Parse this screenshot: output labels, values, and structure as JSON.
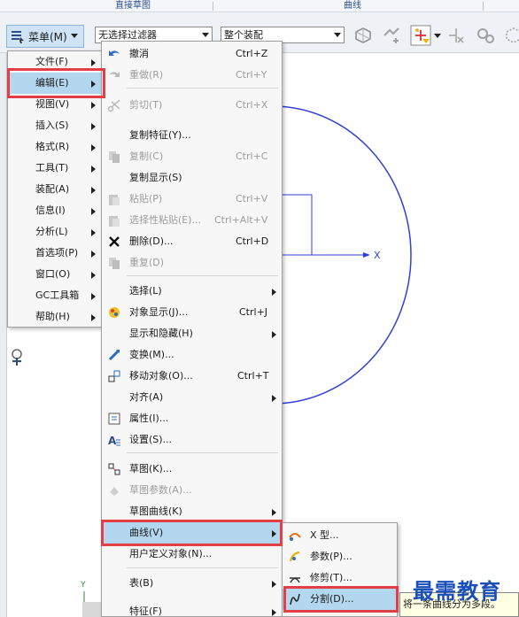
{
  "ribbon_groups": [
    "直接草图",
    "曲线"
  ],
  "toolbar": {
    "menu_button_label": "菜单(M)",
    "filter_combo_value": "无选择过滤器",
    "assembly_combo_value": "整个装配"
  },
  "main_menu": [
    {
      "label": "文件(F)"
    },
    {
      "label": "编辑(E)"
    },
    {
      "label": "视图(V)"
    },
    {
      "label": "插入(S)"
    },
    {
      "label": "格式(R)"
    },
    {
      "label": "工具(T)"
    },
    {
      "label": "装配(A)"
    },
    {
      "label": "信息(I)"
    },
    {
      "label": "分析(L)"
    },
    {
      "label": "首选项(P)"
    },
    {
      "label": "窗口(O)"
    },
    {
      "label": "GC工具箱"
    },
    {
      "label": "帮助(H)"
    }
  ],
  "edit_menu": [
    {
      "label": "撤消",
      "shortcut": "Ctrl+Z"
    },
    {
      "label": "重做(R)",
      "shortcut": "Ctrl+Y"
    },
    {
      "label": "剪切(T)",
      "shortcut": "Ctrl+X"
    },
    {
      "label": "复制特征(Y)...",
      "shortcut": ""
    },
    {
      "label": "复制(C)",
      "shortcut": "Ctrl+C"
    },
    {
      "label": "复制显示(S)",
      "shortcut": ""
    },
    {
      "label": "粘贴(P)",
      "shortcut": "Ctrl+V"
    },
    {
      "label": "选择性粘贴(E)...",
      "shortcut": "Ctrl+Alt+V"
    },
    {
      "label": "删除(D)...",
      "shortcut": "Ctrl+D"
    },
    {
      "label": "重复(D)",
      "shortcut": ""
    },
    {
      "label": "选择(L)",
      "shortcut": ""
    },
    {
      "label": "对象显示(J)...",
      "shortcut": "Ctrl+J"
    },
    {
      "label": "显示和隐藏(H)",
      "shortcut": ""
    },
    {
      "label": "变换(M)...",
      "shortcut": ""
    },
    {
      "label": "移动对象(O)...",
      "shortcut": "Ctrl+T"
    },
    {
      "label": "对齐(A)",
      "shortcut": ""
    },
    {
      "label": "属性(I)...",
      "shortcut": ""
    },
    {
      "label": "设置(S)...",
      "shortcut": ""
    },
    {
      "label": "草图(K)...",
      "shortcut": ""
    },
    {
      "label": "草图参数(A)...",
      "shortcut": ""
    },
    {
      "label": "草图曲线(K)",
      "shortcut": ""
    },
    {
      "label": "曲线(V)",
      "shortcut": ""
    },
    {
      "label": "用户定义对象(N)...",
      "shortcut": ""
    },
    {
      "label": "表(B)",
      "shortcut": ""
    },
    {
      "label": "特征(F)",
      "shortcut": ""
    }
  ],
  "curve_submenu": [
    {
      "label": "X 型..."
    },
    {
      "label": "参数(P)..."
    },
    {
      "label": "修剪(T)..."
    },
    {
      "label": "分割(D)..."
    }
  ],
  "tooltip": "将一条曲线分为多段。",
  "watermark": "最需教育",
  "axis_label_x": "X",
  "axis_label_y": "Y",
  "colors": {
    "highlight": "#b3d7ee",
    "annotation_red": "#e33e46",
    "curve_blue": "#2f3fd8",
    "watermark_blue": "#1a4fb8"
  }
}
